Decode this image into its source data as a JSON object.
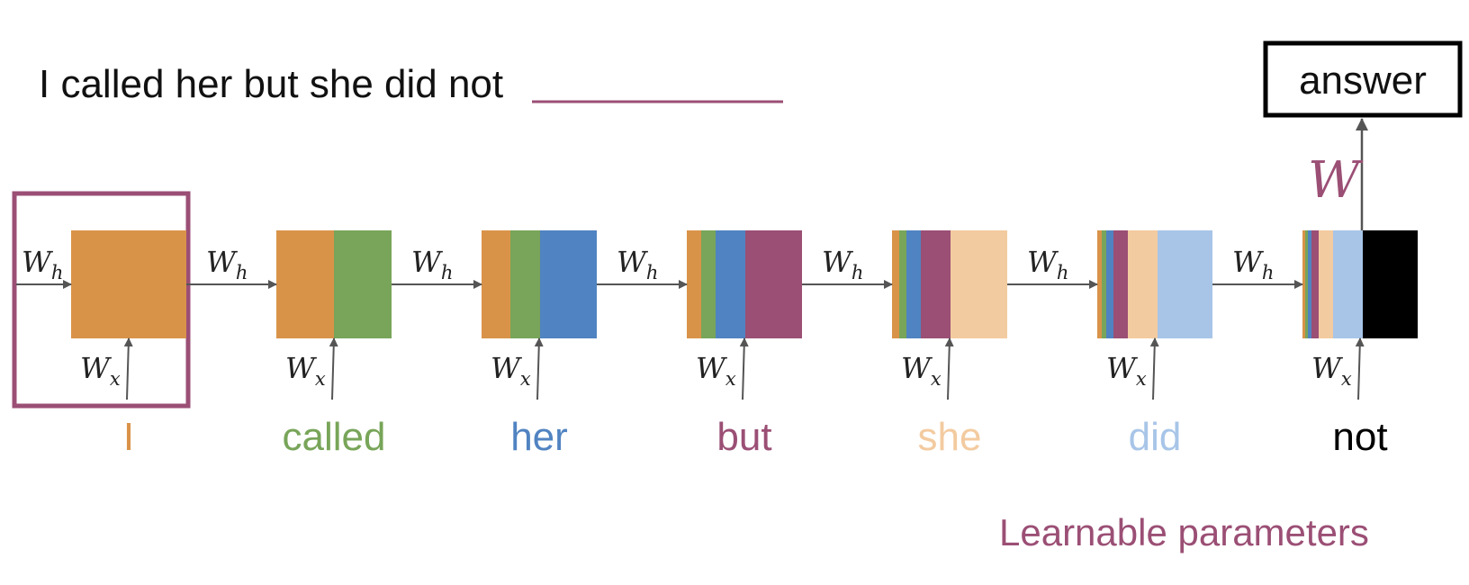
{
  "sentence": {
    "text": "I called her but she did not"
  },
  "answer_label": "answer",
  "output_weight": {
    "symbol": "W"
  },
  "hidden_weight": {
    "base": "W",
    "subscript": "h"
  },
  "input_weight": {
    "base": "W",
    "subscript": "x"
  },
  "footer_label": "Learnable parameters",
  "colors": {
    "accent": "#9b4f75",
    "arrow": "#555555",
    "word_colors": [
      "#d99349",
      "#78a559",
      "#5083c1",
      "#9b4f75",
      "#f3cba0",
      "#a8c5e8",
      "#000000"
    ]
  },
  "steps": [
    {
      "word": "I",
      "color": "#d99349"
    },
    {
      "word": "called",
      "color": "#78a559"
    },
    {
      "word": "her",
      "color": "#5083c1"
    },
    {
      "word": "but",
      "color": "#9b4f75"
    },
    {
      "word": "she",
      "color": "#f3cba0"
    },
    {
      "word": "did",
      "color": "#a8c5e8"
    },
    {
      "word": "not",
      "color": "#000000"
    }
  ]
}
